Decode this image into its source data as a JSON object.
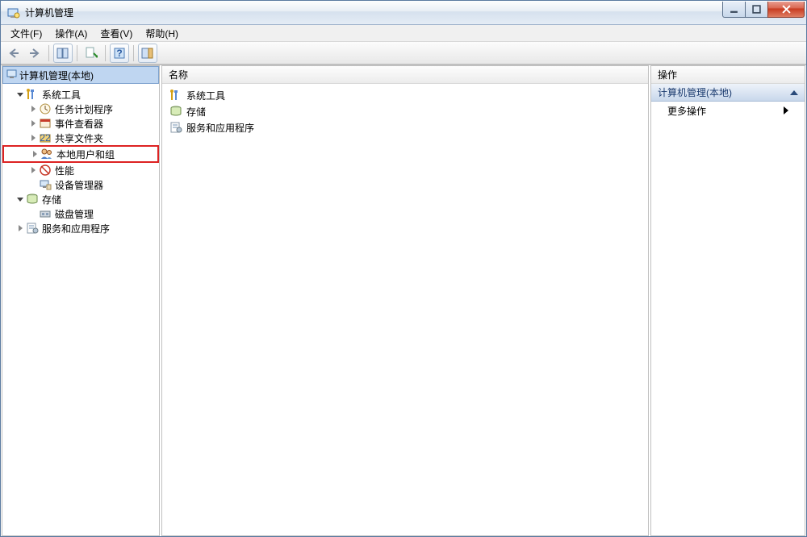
{
  "window": {
    "title": "计算机管理"
  },
  "menu": {
    "file": "文件(F)",
    "action": "操作(A)",
    "view": "查看(V)",
    "help": "帮助(H)"
  },
  "left_header": "计算机管理(本地)",
  "tree": {
    "root_tools": "系统工具",
    "task_scheduler": "任务计划程序",
    "event_viewer": "事件查看器",
    "shared_folders": "共享文件夹",
    "local_users": "本地用户和组",
    "performance": "性能",
    "device_manager": "设备管理器",
    "storage": "存储",
    "disk_mgmt": "磁盘管理",
    "services_apps": "服务和应用程序"
  },
  "center": {
    "header": "名称",
    "items": {
      "sys_tools": "系统工具",
      "storage": "存储",
      "services": "服务和应用程序"
    }
  },
  "right": {
    "header": "操作",
    "section": "计算机管理(本地)",
    "more": "更多操作"
  }
}
